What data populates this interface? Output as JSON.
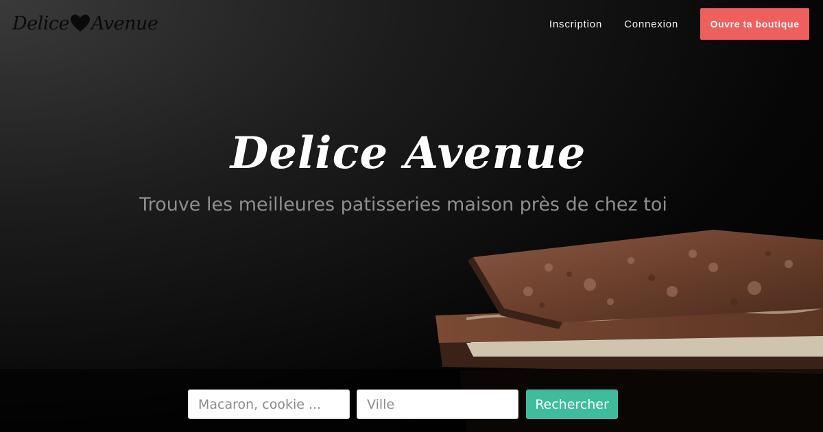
{
  "brand": {
    "logo_left": "Delice",
    "logo_right": "Avenue",
    "heart_icon": "heart-icon"
  },
  "nav": {
    "signup_label": "Inscription",
    "login_label": "Connexion",
    "cta_label": "Ouvre ta boutique"
  },
  "hero": {
    "title": "Delice Avenue",
    "subtitle": "Trouve les meilleures patisseries maison près de chez toi"
  },
  "search": {
    "query_placeholder": "Macaron, cookie ...",
    "city_placeholder": "Ville",
    "button_label": "Rechercher"
  },
  "colors": {
    "cta": "#ef5f5c",
    "search_button": "#3dbd9b"
  }
}
